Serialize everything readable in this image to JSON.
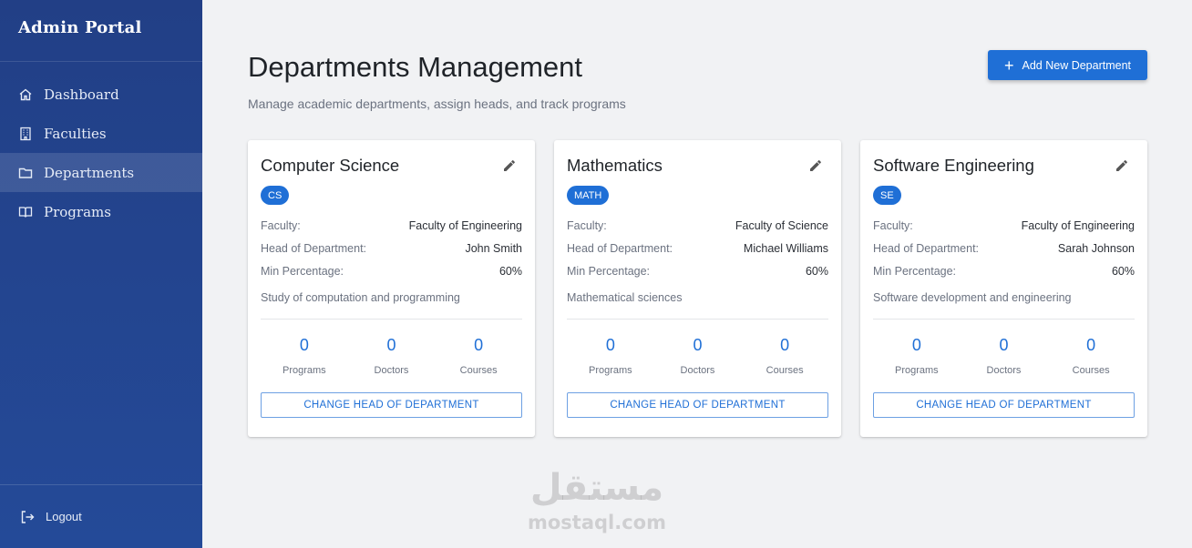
{
  "sidebar": {
    "brand": "Admin Portal",
    "items": [
      {
        "label": "Dashboard",
        "icon": "home-icon"
      },
      {
        "label": "Faculties",
        "icon": "building-icon"
      },
      {
        "label": "Departments",
        "icon": "folder-icon",
        "active": true
      },
      {
        "label": "Programs",
        "icon": "book-icon"
      }
    ],
    "logout": "Logout"
  },
  "header": {
    "title": "Departments Management",
    "subtitle": "Manage academic departments, assign heads, and track programs",
    "add_button": "Add New Department"
  },
  "labels": {
    "faculty": "Faculty:",
    "head": "Head of Department:",
    "min_pct": "Min Percentage:",
    "programs": "Programs",
    "doctors": "Doctors",
    "courses": "Courses",
    "change_head": "CHANGE HEAD OF DEPARTMENT"
  },
  "departments": [
    {
      "name": "Computer Science",
      "code": "CS",
      "faculty": "Faculty of Engineering",
      "head": "John Smith",
      "min_percentage": "60%",
      "description": "Study of computation and programming",
      "programs": "0",
      "doctors": "0",
      "courses": "0"
    },
    {
      "name": "Mathematics",
      "code": "MATH",
      "faculty": "Faculty of Science",
      "head": "Michael Williams",
      "min_percentage": "60%",
      "description": "Mathematical sciences",
      "programs": "0",
      "doctors": "0",
      "courses": "0"
    },
    {
      "name": "Software Engineering",
      "code": "SE",
      "faculty": "Faculty of Engineering",
      "head": "Sarah Johnson",
      "min_percentage": "60%",
      "description": "Software development and engineering",
      "programs": "0",
      "doctors": "0",
      "courses": "0"
    }
  ],
  "watermark": {
    "arabic": "مستقل",
    "latin": "mostaql.com"
  },
  "colors": {
    "sidebar": "#223f86",
    "accent": "#1f6fd6",
    "background": "#f1f2f4"
  }
}
